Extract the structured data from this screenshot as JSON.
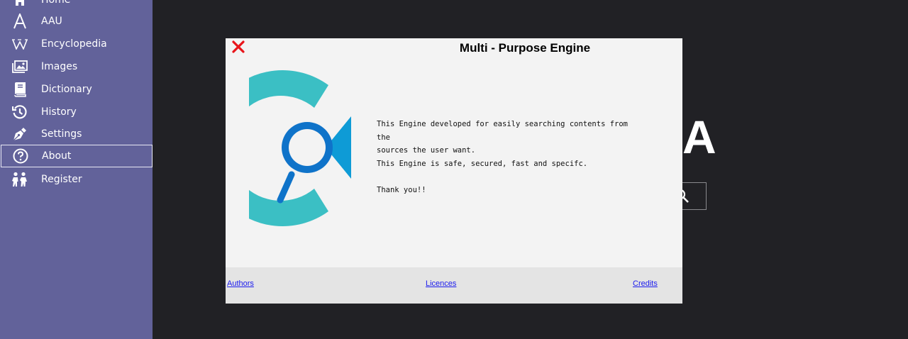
{
  "sidebar": {
    "items": [
      {
        "label": "Home",
        "icon": "home-icon"
      },
      {
        "label": "AAU",
        "icon": "aau-logo-icon"
      },
      {
        "label": "Encyclopedia",
        "icon": "wikipedia-icon"
      },
      {
        "label": "Images",
        "icon": "images-icon"
      },
      {
        "label": "Dictionary",
        "icon": "book-icon"
      },
      {
        "label": "History",
        "icon": "history-icon"
      },
      {
        "label": "Settings",
        "icon": "pen-nib-icon"
      },
      {
        "label": "About",
        "icon": "question-icon",
        "active": true
      },
      {
        "label": "Register",
        "icon": "people-icon"
      }
    ]
  },
  "background": {
    "logo_letter": "A"
  },
  "modal": {
    "title": "Multi - Purpose Engine",
    "body_lines": [
      "This Engine developed for easily searching contents from the",
      "sources the user want.",
      "This Engine is safe, secured, fast and specifc."
    ],
    "thanks": "Thank you!!",
    "footer": {
      "authors": "Authors",
      "licences": "Licences",
      "credits": "Credits"
    }
  },
  "colors": {
    "sidebar_bg": "#62629a",
    "main_bg": "#212125",
    "modal_bg": "#f3f3f3",
    "footer_bg": "#e4e4e4",
    "logo_teal": "#3bbfc4",
    "logo_blue": "#0f73c9",
    "close_red": "#e8141a",
    "link_blue": "#1a1aee"
  }
}
